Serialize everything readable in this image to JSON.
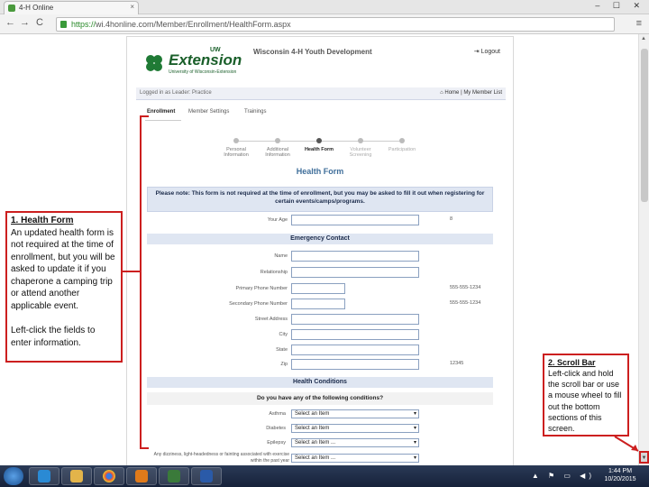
{
  "browser": {
    "tab_title": "4-H Online",
    "tab_close": "×",
    "url_scheme": "https://",
    "url_rest": "wi.4honline.com/Member/Enrollment/HealthForm.aspx",
    "back": "←",
    "forward": "→",
    "reload": "C",
    "window_controls": "– ☐ ✕",
    "menu": "≡"
  },
  "site": {
    "logo_uw": "UW",
    "logo_text": "Extension",
    "logo_sub": "University of Wisconsin-Extension",
    "title": "Wisconsin 4-H Youth Development",
    "logout": "Logout",
    "logged_in": "Logged in as Leader: Practice",
    "home": "Home",
    "my_member_list": "My Member List"
  },
  "tabs": {
    "enrollment": "Enrollment",
    "member_settings": "Member Settings",
    "trainings": "Trainings"
  },
  "steps": [
    {
      "label": "Personal Information"
    },
    {
      "label": "Additional Information"
    },
    {
      "label": "Health Form"
    },
    {
      "label": "Volunteer Screening"
    },
    {
      "label": "Participation"
    }
  ],
  "form": {
    "title": "Health Form",
    "notice": "Please note: This form is not required at the time of enrollment, but you may be asked to fill it out when registering for certain events/camps/programs.",
    "your_age_label": "Your Age",
    "your_age_value": "8",
    "emergency_contact": "Emergency Contact",
    "fields": [
      {
        "label": "Name",
        "value": ""
      },
      {
        "label": "Relationship",
        "value": ""
      },
      {
        "label": "Primary Phone Number",
        "value": "555-555-1234"
      },
      {
        "label": "Secondary Phone Number",
        "value": "555-555-1234"
      },
      {
        "label": "Street Address",
        "value": ""
      },
      {
        "label": "City",
        "value": ""
      },
      {
        "label": "State",
        "value": ""
      },
      {
        "label": "Zip",
        "value": "12345"
      }
    ],
    "health_conditions": "Health Conditions",
    "question": "Do you have any of the following conditions?",
    "conditions": [
      {
        "label": "Asthma",
        "selected": "Select an Item"
      },
      {
        "label": "Diabetes",
        "selected": "Select an Item"
      },
      {
        "label": "Epilepsy",
        "selected": "Select an Item ..."
      }
    ],
    "long_question": "Any dizziness, light-headedness or fainting associated with exercise within the past year",
    "long_select": "Select an Item ..."
  },
  "callouts": {
    "health_form_title": "1. Health Form",
    "health_form_body": "An updated health form is not required at the time of enrollment, but you will be asked to update it if you chaperone a camping trip or attend another applicable event.",
    "health_form_body2": "Left-click the fields to enter information.",
    "scroll_title": "2. Scroll Bar",
    "scroll_body": "Left-click and hold the scroll bar or use a mouse wheel to fill out the bottom sections of this screen."
  },
  "taskbar": {
    "time": "1:44 PM",
    "date": "10/20/2015",
    "tray_icons": "▲ ⚑ ▭ ◀)"
  }
}
